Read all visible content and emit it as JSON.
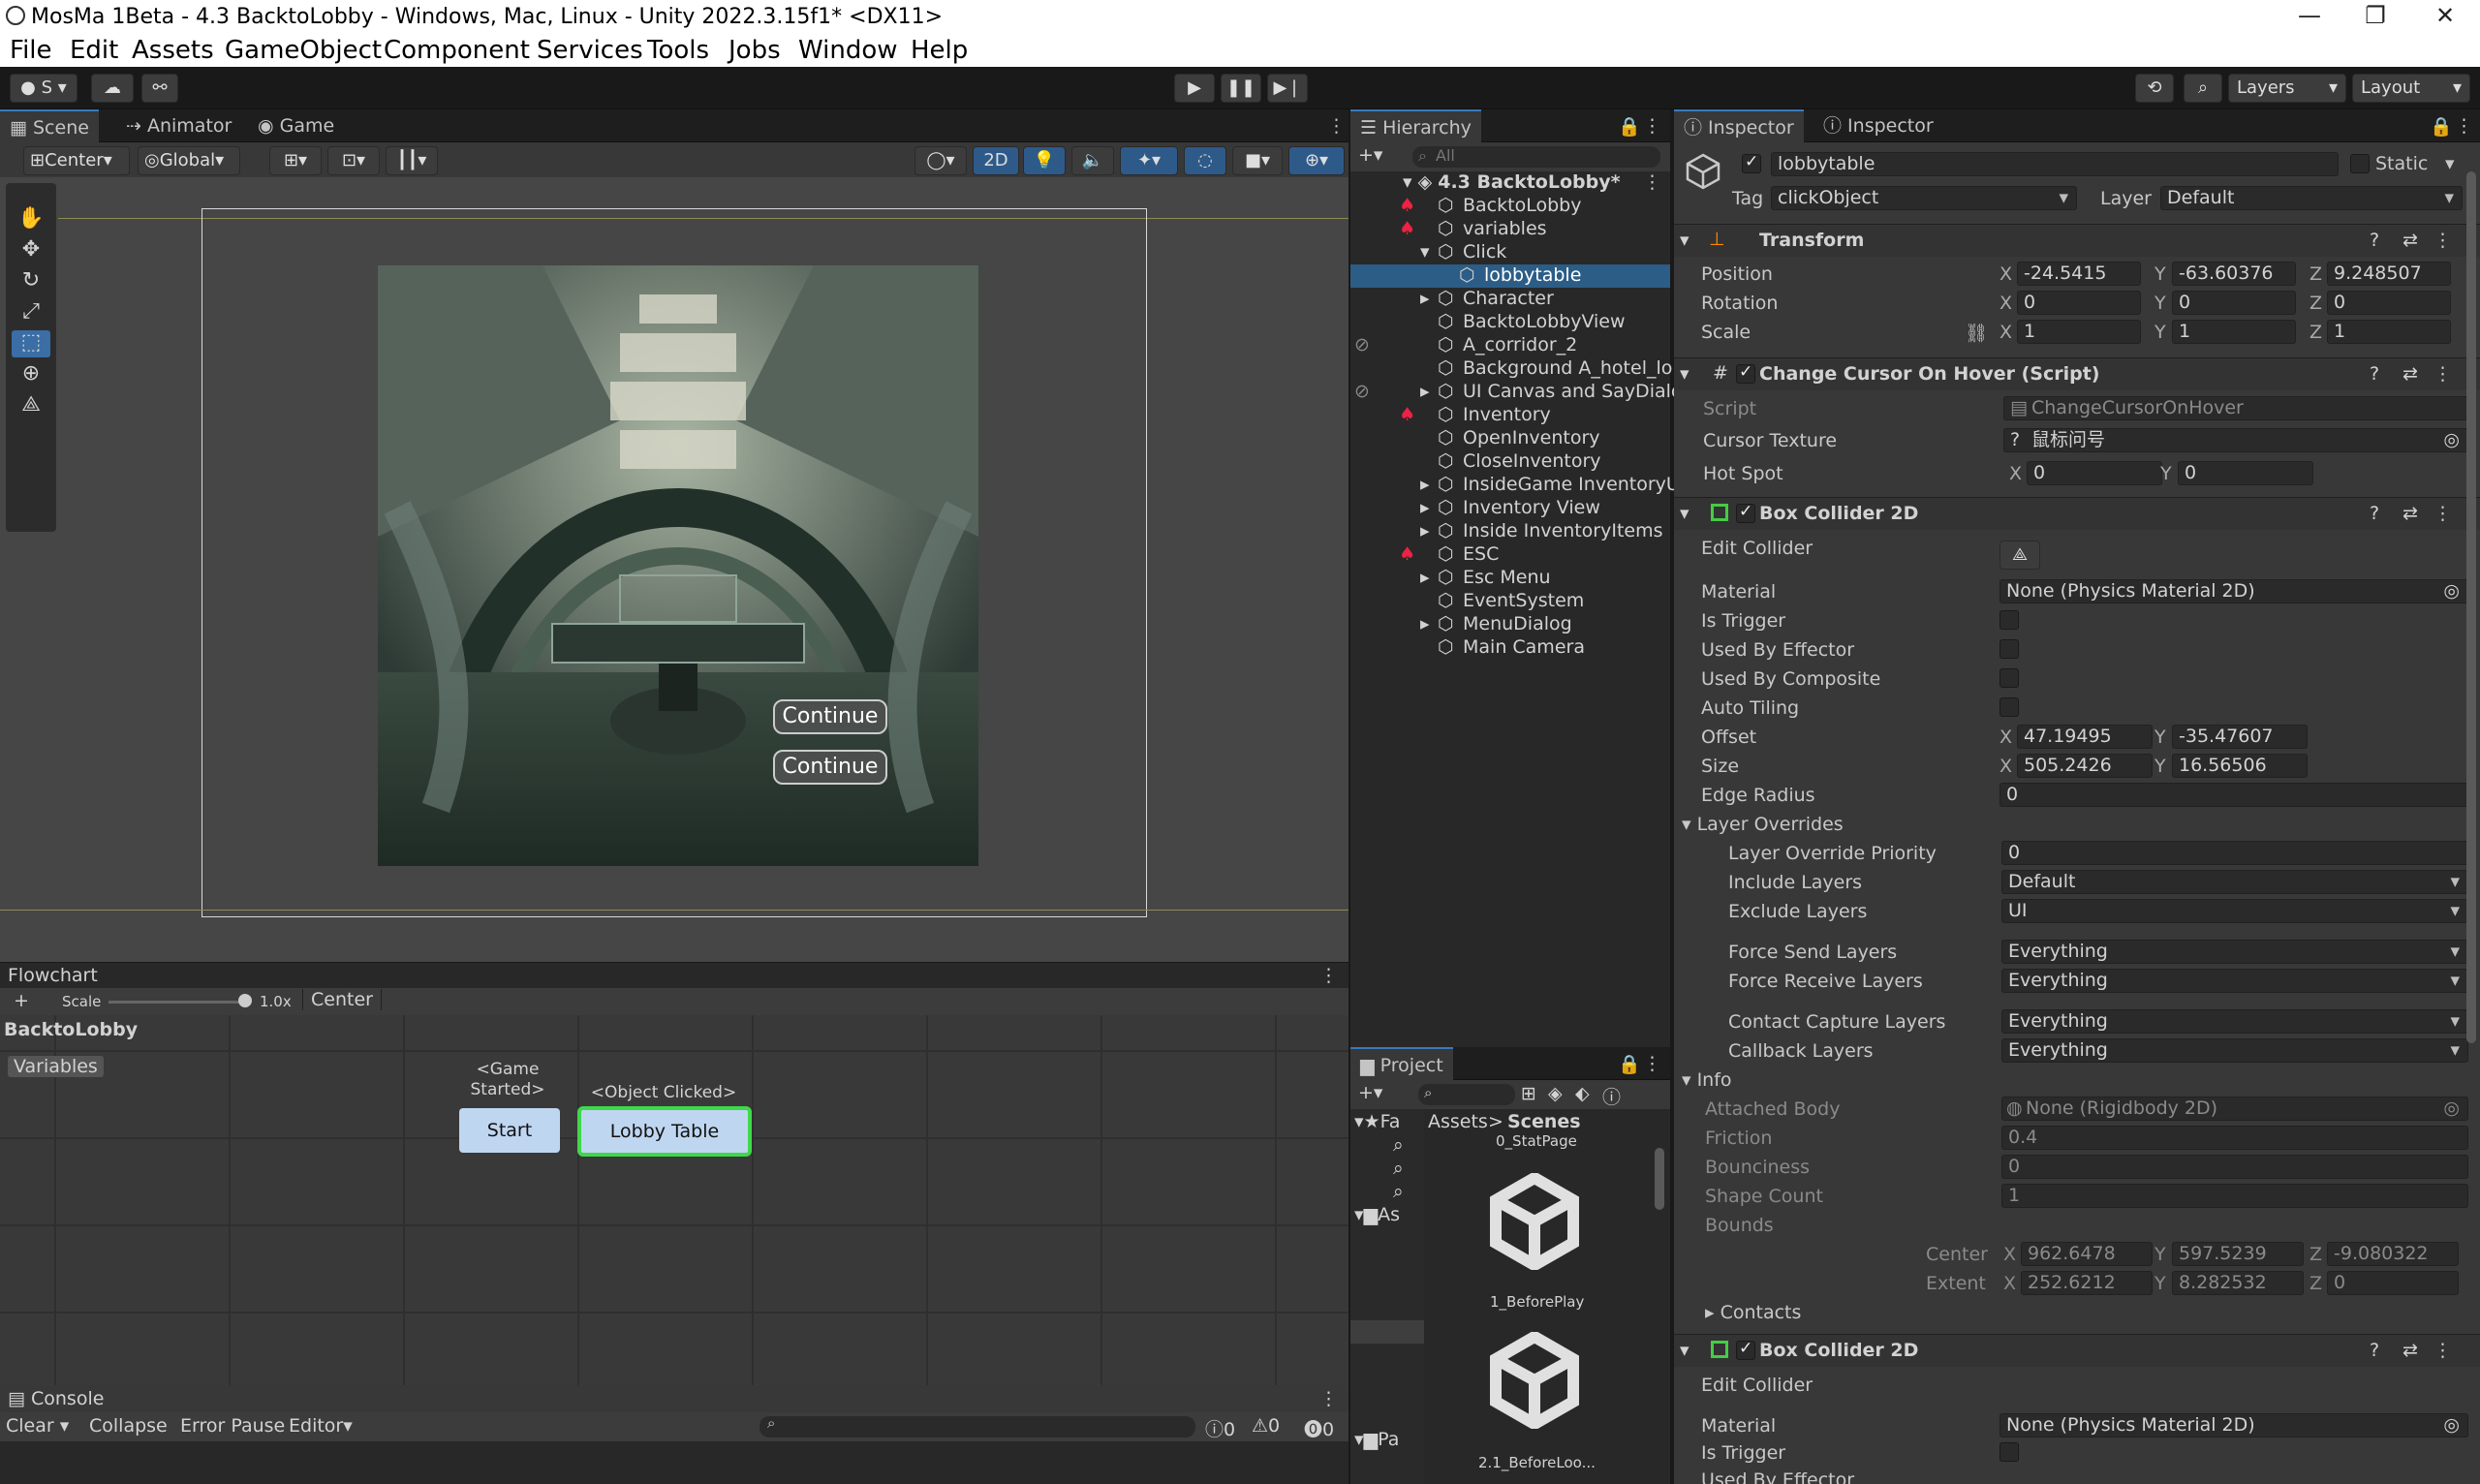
{
  "window": {
    "title": "MosMa 1Beta - 4.3 BacktoLobby - Windows, Mac, Linux - Unity 2022.3.15f1* <DX11>",
    "minimize": "—",
    "maximize": "❐",
    "close": "✕"
  },
  "menu": [
    "File",
    "Edit",
    "Assets",
    "GameObject",
    "Component",
    "Services",
    "Tools",
    "Jobs",
    "Window",
    "Help"
  ],
  "toolbar": {
    "account": "S",
    "layers": "Layers",
    "layout": "Layout"
  },
  "scene": {
    "tabs": [
      "Scene",
      "Animator",
      "Game"
    ],
    "pivot": "Center",
    "space": "Global",
    "mode2d": "2D",
    "buttons": [
      "Continue",
      "Continue"
    ]
  },
  "flowchart": {
    "title": "Flowchart",
    "add": "+",
    "scale_label": "Scale",
    "scale_value": "1.0x",
    "center": "Center",
    "name": "BacktoLobby",
    "variables": "Variables",
    "start_event": "<Game\nStarted>",
    "start_block": "Start",
    "click_event": "<Object Clicked>",
    "click_block": "Lobby Table"
  },
  "console": {
    "title": "Console",
    "clear": "Clear",
    "collapse": "Collapse",
    "error_pause": "Error Pause",
    "editor": "Editor",
    "counts": [
      "0",
      "0",
      "0"
    ]
  },
  "hierarchy": {
    "title": "Hierarchy",
    "search_placeholder": "All",
    "scene": "4.3 BacktoLobby*",
    "items": [
      "BacktoLobby",
      "variables",
      "Click",
      "lobbytable",
      "Character",
      "BacktoLobbyView",
      "A_corridor_2",
      "Background A_hotel_lob",
      "UI Canvas and SayDialo",
      "Inventory",
      "OpenInventory",
      "CloseInventory",
      "InsideGame InventoryUI",
      "Inventory View",
      "Inside InventoryItems",
      "ESC",
      "Esc Menu",
      "EventSystem",
      "MenuDialog",
      "Main Camera"
    ]
  },
  "project": {
    "title": "Project",
    "breadcrumb": [
      "Assets",
      "Scenes"
    ],
    "top_label": "0_StatPage",
    "assets": [
      "1_BeforePlay",
      "2.1_BeforeLoo..."
    ],
    "tree_labels": [
      "Fa",
      "As",
      "Pa"
    ]
  },
  "inspector": {
    "tabs": [
      "Inspector",
      "Inspector"
    ],
    "object_name": "lobbytable",
    "static": "Static",
    "tag_label": "Tag",
    "tag": "clickObject",
    "layer_label": "Layer",
    "layer": "Default",
    "transform": {
      "title": "Transform",
      "position": [
        "-24.5415",
        "-63.60376",
        "9.248507"
      ],
      "rotation": [
        "0",
        "0",
        "0"
      ],
      "scale": [
        "1",
        "1",
        "1"
      ],
      "labels": [
        "Position",
        "Rotation",
        "Scale"
      ]
    },
    "script": {
      "title": "Change Cursor On Hover (Script)",
      "script_label": "Script",
      "script": "ChangeCursorOnHover",
      "cursor_label": "Cursor Texture",
      "cursor": "鼠标问号",
      "hotspot_label": "Hot Spot",
      "hotspot": [
        "0",
        "0"
      ]
    },
    "collider": {
      "title": "Box Collider 2D",
      "edit": "Edit Collider",
      "material_label": "Material",
      "material": "None (Physics Material 2D)",
      "labels": [
        "Is Trigger",
        "Used By Effector",
        "Used By Composite",
        "Auto Tiling"
      ],
      "offset_label": "Offset",
      "offset": [
        "47.19495",
        "-35.47607"
      ],
      "size_label": "Size",
      "size": [
        "505.2426",
        "16.56506"
      ],
      "edge_label": "Edge Radius",
      "edge": "0",
      "layer_overrides": "Layer Overrides",
      "lop_label": "Layer Override Priority",
      "lop": "0",
      "include_label": "Include Layers",
      "include": "Default",
      "exclude_label": "Exclude Layers",
      "exclude": "UI",
      "fsend_label": "Force Send Layers",
      "fsend": "Everything",
      "frecv_label": "Force Receive Layers",
      "frecv": "Everything",
      "contact_label": "Contact Capture Layers",
      "contact": "Everything",
      "callback_label": "Callback Layers",
      "callback": "Everything",
      "info": "Info",
      "body_label": "Attached Body",
      "body": "None (Rigidbody 2D)",
      "friction_label": "Friction",
      "friction": "0.4",
      "bounce_label": "Bounciness",
      "bounce": "0",
      "shape_label": "Shape Count",
      "shape": "1",
      "bounds_label": "Bounds",
      "center_label": "Center",
      "center": [
        "962.6478",
        "597.5239",
        "-9.080322"
      ],
      "extent_label": "Extent",
      "extent": [
        "252.6212",
        "8.282532",
        "0"
      ],
      "contacts": "Contacts"
    },
    "collider2": {
      "title": "Box Collider 2D",
      "edit": "Edit Collider",
      "material_label": "Material",
      "material": "None (Physics Material 2D)",
      "trigger_label": "Is Trigger",
      "effector_label": "Used By Effector"
    }
  },
  "axes": {
    "x": "X",
    "y": "Y",
    "z": "Z"
  }
}
